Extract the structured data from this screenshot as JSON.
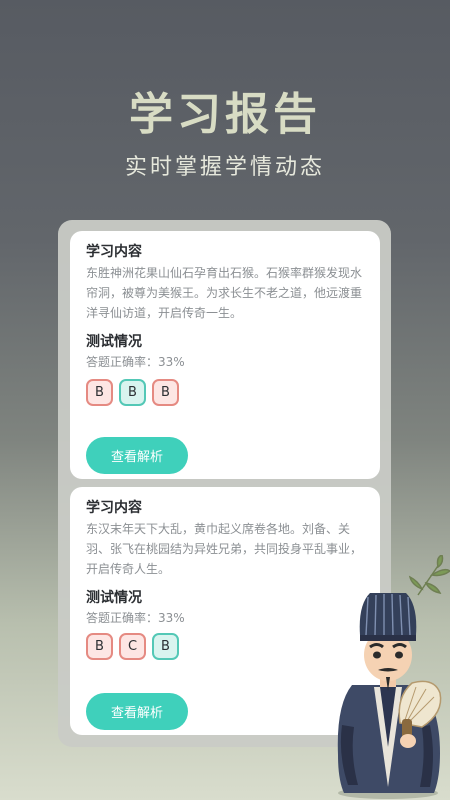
{
  "header": {
    "title": "学习报告",
    "subtitle": "实时掌握学情动态"
  },
  "reports": [
    {
      "content_heading": "学习内容",
      "content_text": "东胜神洲花果山仙石孕育出石猴。石猴率群猴发现水帘洞，被尊为美猴王。为求长生不老之道，他远渡重洋寻仙访道，开启传奇一生。",
      "test_heading": "测试情况",
      "accuracy": "答题正确率：33%",
      "answers": [
        {
          "letter": "B",
          "result": "wrong"
        },
        {
          "letter": "B",
          "result": "right"
        },
        {
          "letter": "B",
          "result": "wrong"
        }
      ],
      "button": "查看解析"
    },
    {
      "content_heading": "学习内容",
      "content_text": "东汉末年天下大乱，黄巾起义席卷各地。刘备、关羽、张飞在桃园结为异姓兄弟，共同投身平乱事业，开启传奇人生。",
      "test_heading": "测试情况",
      "accuracy": "答题正确率：33%",
      "answers": [
        {
          "letter": "B",
          "result": "wrong"
        },
        {
          "letter": "C",
          "result": "wrong"
        },
        {
          "letter": "B",
          "result": "right"
        }
      ],
      "button": "查看解析"
    }
  ],
  "colors": {
    "accent": "#3fd0bb",
    "wrong": "#e58a82",
    "right": "#53c8b6"
  },
  "illustration": "scholar-character-with-feather-fan"
}
